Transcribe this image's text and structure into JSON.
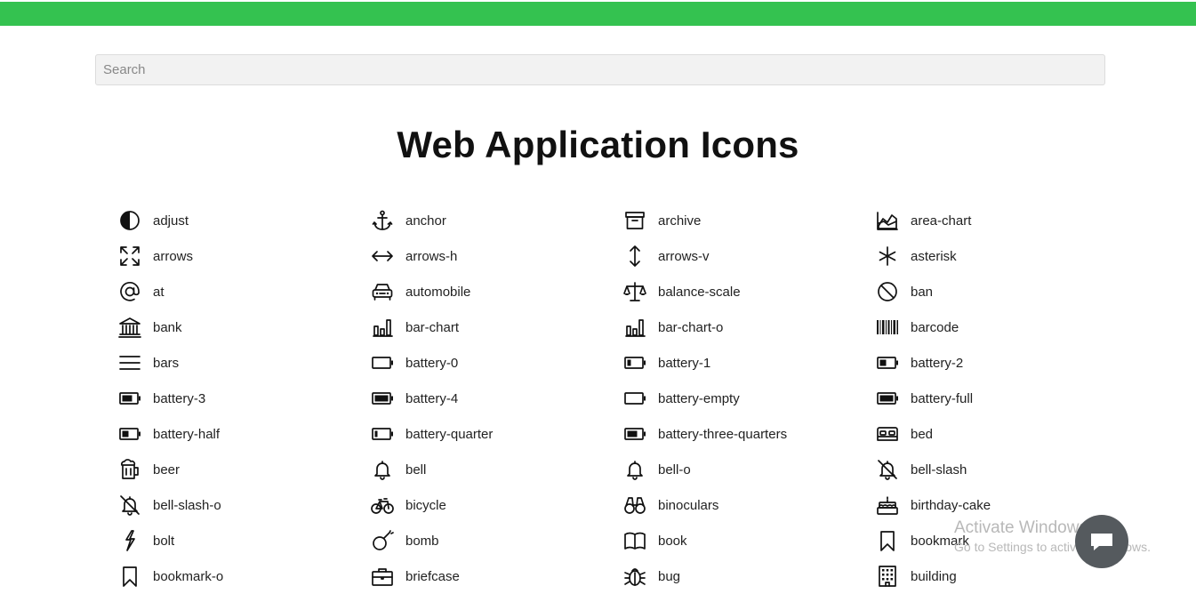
{
  "search": {
    "placeholder": "Search"
  },
  "page": {
    "title": "Web Application Icons"
  },
  "icons": [
    "adjust",
    "anchor",
    "archive",
    "area-chart",
    "arrows",
    "arrows-h",
    "arrows-v",
    "asterisk",
    "at",
    "automobile",
    "balance-scale",
    "ban",
    "bank",
    "bar-chart",
    "bar-chart-o",
    "barcode",
    "bars",
    "battery-0",
    "battery-1",
    "battery-2",
    "battery-3",
    "battery-4",
    "battery-empty",
    "battery-full",
    "battery-half",
    "battery-quarter",
    "battery-three-quarters",
    "bed",
    "beer",
    "bell",
    "bell-o",
    "bell-slash",
    "bell-slash-o",
    "bicycle",
    "binoculars",
    "birthday-cake",
    "bolt",
    "bomb",
    "book",
    "bookmark",
    "bookmark-o",
    "briefcase",
    "bug",
    "building"
  ],
  "watermark": {
    "title": "Activate Windows",
    "subtitle": "Go to Settings to activate Windows."
  },
  "chat": {
    "icon": "chat-icon"
  },
  "colors": {
    "topbar": "#34c250",
    "chat_button": "#555a5e"
  }
}
